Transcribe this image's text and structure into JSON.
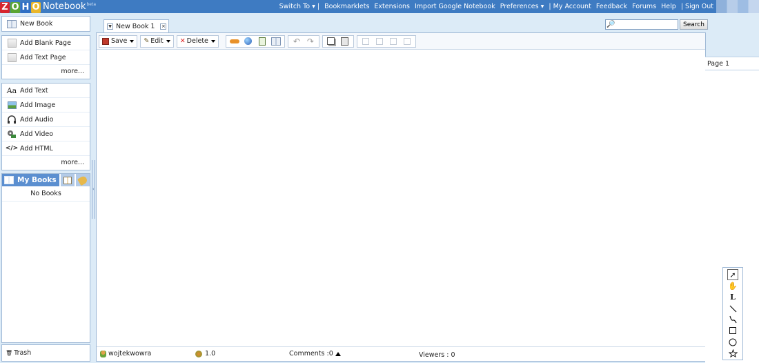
{
  "app": {
    "logo_letters": [
      "Z",
      "O",
      "H",
      "O"
    ],
    "product": "Notebook",
    "badge": "beta"
  },
  "topnav": {
    "items": [
      "Switch To ▾ |",
      "Bookmarklets",
      "Extensions",
      "Import Google Notebook",
      "Preferences ▾",
      "| My Account",
      "Feedback",
      "Forums",
      "Help",
      "| Sign Out"
    ]
  },
  "sidebar": {
    "new_book": "New Book",
    "pages": {
      "add_blank": "Add Blank Page",
      "add_text": "Add Text Page",
      "more": "more..."
    },
    "content": {
      "items": [
        {
          "label": "Add Text",
          "icon": "text-aa-icon"
        },
        {
          "label": "Add Image",
          "icon": "image-icon"
        },
        {
          "label": "Add Audio",
          "icon": "audio-headphones-icon"
        },
        {
          "label": "Add Video",
          "icon": "video-film-icon"
        },
        {
          "label": "Add HTML",
          "icon": "html-code-icon"
        }
      ],
      "more": "more..."
    },
    "my_books": {
      "title": "My Books",
      "empty": "No Books"
    },
    "trash": "Trash"
  },
  "tab": {
    "label": "New Book 1"
  },
  "toolbar": {
    "save": "Save",
    "edit": "Edit",
    "delete": "Delete"
  },
  "search": {
    "placeholder": "",
    "button": "Search"
  },
  "pages": {
    "items": [
      "Page 1"
    ]
  },
  "status": {
    "user": "wojtekwowra",
    "version": "1.0",
    "comments": "Comments :0",
    "viewers": "Viewers :  0"
  },
  "colors": {
    "topbar": "#3e7bc2",
    "sidebar_bg": "#dcebf7",
    "accent_tab": "#5b8fd0",
    "border": "#9fb9d6"
  }
}
